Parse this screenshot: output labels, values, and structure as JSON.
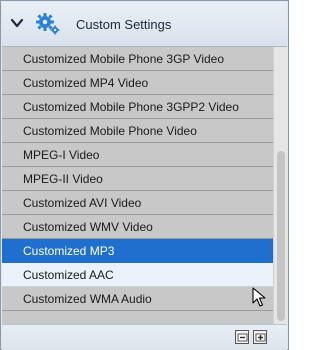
{
  "header": {
    "title": "Custom Settings",
    "collapse_icon": "chevron-down-icon",
    "settings_icon": "gear-icon"
  },
  "list": {
    "items": [
      {
        "label": "Customized Mobile Phone 3GP Video"
      },
      {
        "label": "Customized MP4 Video"
      },
      {
        "label": "Customized Mobile Phone 3GPP2 Video"
      },
      {
        "label": "Customized Mobile Phone Video"
      },
      {
        "label": "MPEG-I Video"
      },
      {
        "label": "MPEG-II Video"
      },
      {
        "label": "Customized AVI Video"
      },
      {
        "label": "Customized WMV Video"
      },
      {
        "label": "Customized MP3"
      },
      {
        "label": "Customized AAC"
      },
      {
        "label": "Customized WMA Audio"
      }
    ],
    "selected_item": "Customized MP3",
    "hovered_item": "Customized AAC"
  },
  "footer": {
    "left_icon": "delete-item-icon",
    "right_icon": "add-item-icon"
  },
  "colors": {
    "selected_bg": "#1f6fcf",
    "hover_bg": "#eaf2fb",
    "row_bg": "#c8c8c8",
    "gear_blue": "#2a7fd6"
  }
}
